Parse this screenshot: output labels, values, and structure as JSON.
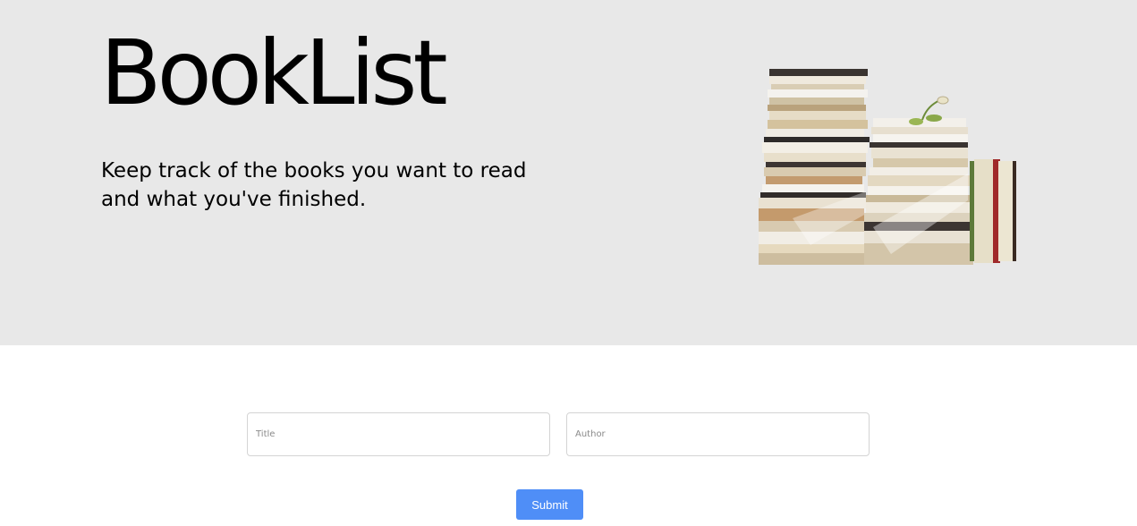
{
  "hero": {
    "title": "BookList",
    "tagline": "Keep track of the books you want to read and what you've finished.",
    "image_icon": "stacked-books-photo"
  },
  "form": {
    "title_placeholder": "Title",
    "author_placeholder": "Author",
    "title_value": "",
    "author_value": "",
    "submit_label": "Submit"
  },
  "colors": {
    "hero_background": "#e8e8e8",
    "submit_button": "#4f8ef7",
    "input_border": "#d4d4d4"
  }
}
